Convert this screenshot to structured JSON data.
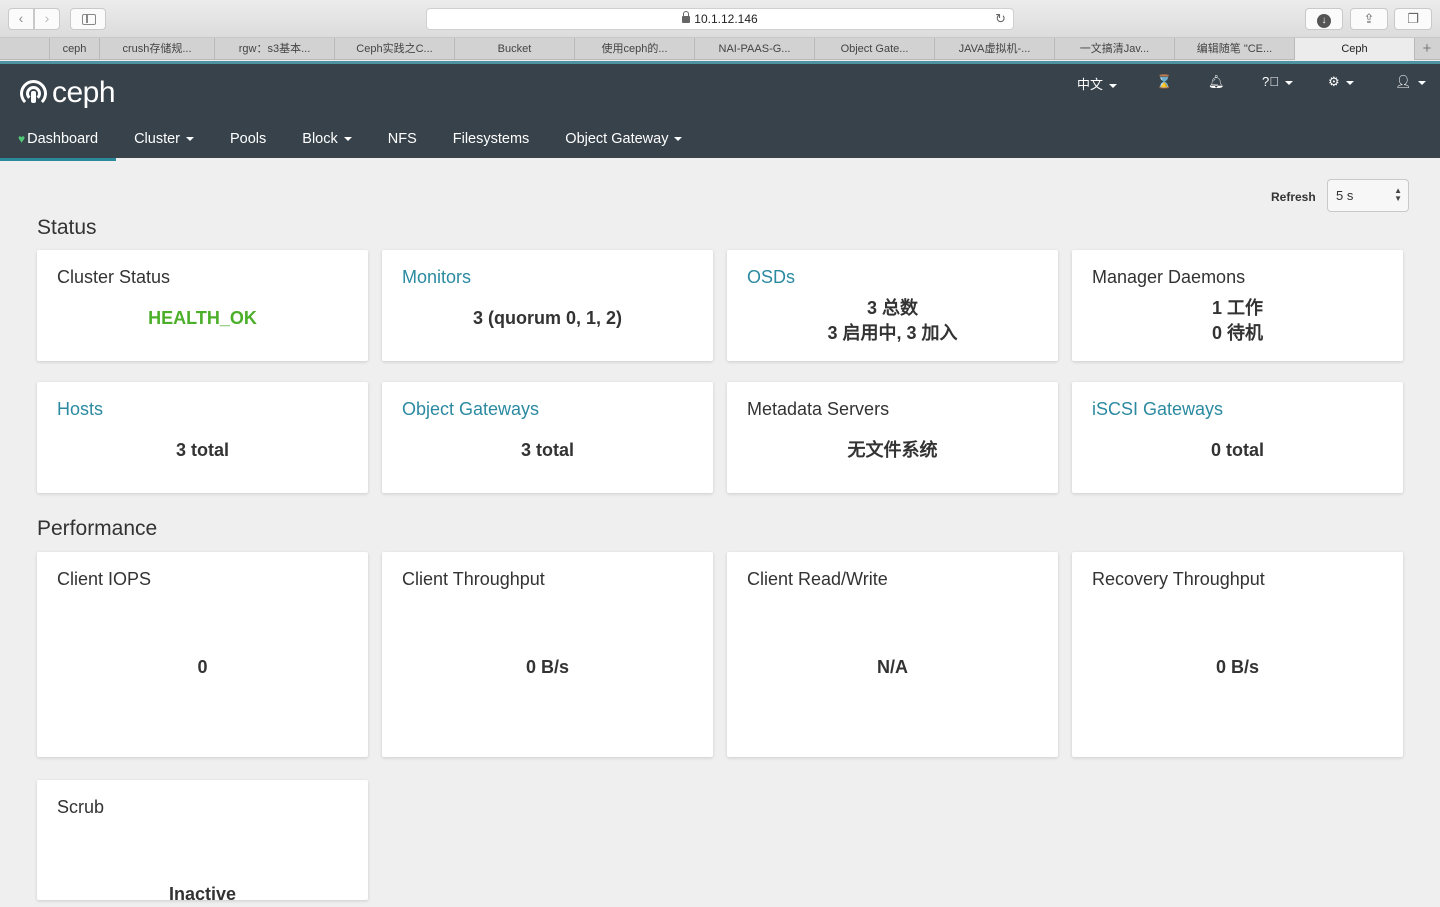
{
  "browser": {
    "url": "10.1.12.146",
    "tabs": [
      {
        "label": "ceph",
        "w": 50
      },
      {
        "label": "crush存储规...",
        "w": 115
      },
      {
        "label": "rgw：s3基本...",
        "w": 120
      },
      {
        "label": "Ceph实践之C...",
        "w": 120
      },
      {
        "label": "Bucket",
        "w": 120
      },
      {
        "label": "使用ceph的...",
        "w": 120
      },
      {
        "label": "NAI-PAAS-G...",
        "w": 120
      },
      {
        "label": "Object Gate...",
        "w": 120
      },
      {
        "label": "JAVA虚拟机-...",
        "w": 120
      },
      {
        "label": "一文搞清Jav...",
        "w": 120
      },
      {
        "label": "编辑随笔 \"CE...",
        "w": 120
      },
      {
        "label": "Ceph",
        "w": 120
      }
    ],
    "new_tab": "+"
  },
  "navbar": {
    "brand": "ceph",
    "language": "中文",
    "menu": {
      "dashboard": "Dashboard",
      "cluster": "Cluster",
      "pools": "Pools",
      "block": "Block",
      "nfs": "NFS",
      "filesystems": "Filesystems",
      "object_gateway": "Object Gateway"
    }
  },
  "refresh": {
    "label": "Refresh",
    "value": "5 s"
  },
  "status": {
    "title": "Status",
    "cluster_status": {
      "title": "Cluster Status",
      "value": "HEALTH_OK"
    },
    "monitors": {
      "title": "Monitors",
      "value": "3 (quorum 0, 1, 2)"
    },
    "osds": {
      "title": "OSDs",
      "line1": "3 总数",
      "line2": "3 启用中, 3 加入"
    },
    "manager_daemons": {
      "title": "Manager Daemons",
      "line1": "1 工作",
      "line2": "0 待机"
    },
    "hosts": {
      "title": "Hosts",
      "value": "3 total"
    },
    "object_gateways": {
      "title": "Object Gateways",
      "value": "3 total"
    },
    "metadata_servers": {
      "title": "Metadata Servers",
      "value": "无文件系统"
    },
    "iscsi_gateways": {
      "title": "iSCSI Gateways",
      "value": "0 total"
    }
  },
  "performance": {
    "title": "Performance",
    "client_iops": {
      "title": "Client IOPS",
      "value": "0"
    },
    "client_throughput": {
      "title": "Client Throughput",
      "value": "0 B/s"
    },
    "client_read_write": {
      "title": "Client Read/Write",
      "value": "N/A"
    },
    "recovery_throughput": {
      "title": "Recovery Throughput",
      "value": "0 B/s"
    },
    "scrub": {
      "title": "Scrub",
      "value": "Inactive"
    }
  },
  "colors": {
    "navbar": "#37424a",
    "accent": "#2b8aa1",
    "ok": "#4caf2a"
  }
}
